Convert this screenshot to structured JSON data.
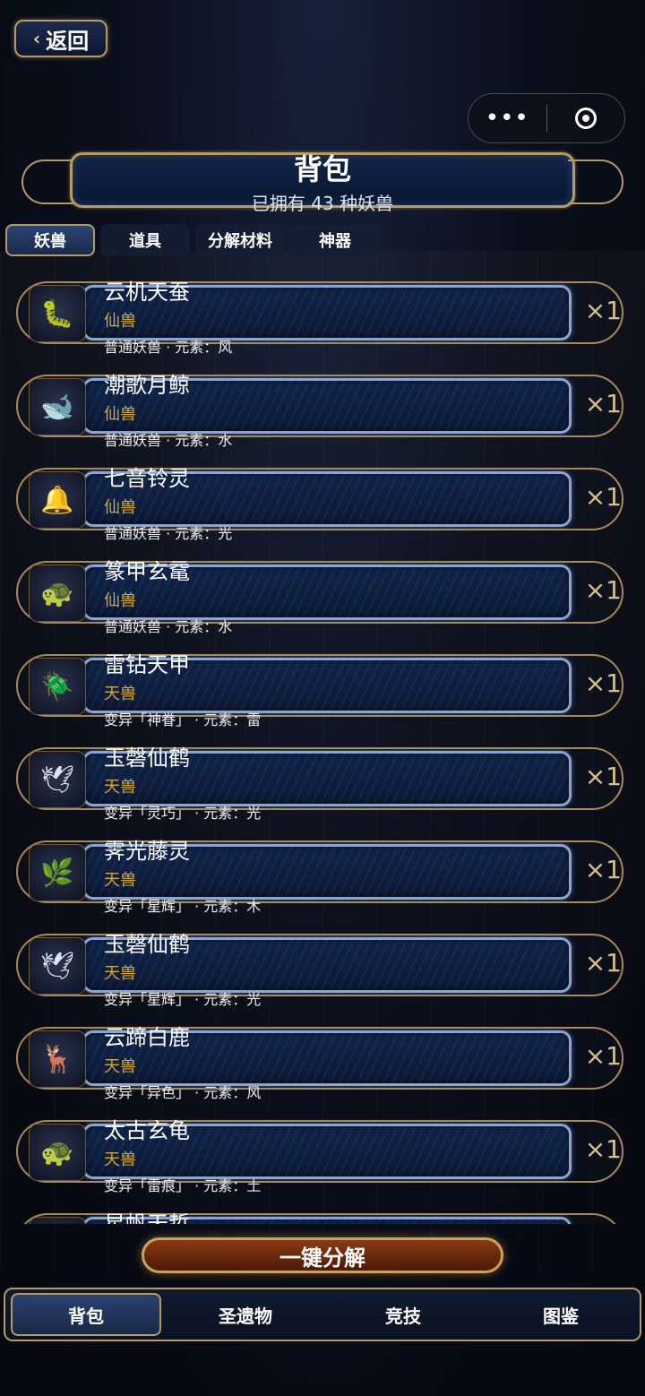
{
  "header": {
    "back_label": "返回",
    "title": "背包",
    "subtitle": "已拥有 43 种妖兽"
  },
  "tabs": [
    {
      "label": "妖兽",
      "active": true
    },
    {
      "label": "道具",
      "active": false
    },
    {
      "label": "分解材料",
      "active": false
    },
    {
      "label": "神器",
      "active": false
    }
  ],
  "items": [
    {
      "name": "云机天蚕",
      "rank": "仙兽",
      "detail": "普通妖兽 · 元素：风",
      "count": "×1",
      "icon": "silkworm-icon"
    },
    {
      "name": "潮歌月鲸",
      "rank": "仙兽",
      "detail": "普通妖兽 · 元素：水",
      "count": "×1",
      "icon": "whale-icon"
    },
    {
      "name": "七音铃灵",
      "rank": "仙兽",
      "detail": "普通妖兽 · 元素：光",
      "count": "×1",
      "icon": "bell-spirit-icon"
    },
    {
      "name": "篆甲玄鼋",
      "rank": "仙兽",
      "detail": "普通妖兽 · 元素：水",
      "count": "×1",
      "icon": "turtle-icon"
    },
    {
      "name": "雷钻天甲",
      "rank": "天兽",
      "detail": "变异「神眷」 · 元素：雷",
      "count": "×1",
      "icon": "beetle-icon"
    },
    {
      "name": "玉磬仙鹤",
      "rank": "天兽",
      "detail": "变异「灵巧」 · 元素：光",
      "count": "×1",
      "icon": "crane-icon"
    },
    {
      "name": "霁光藤灵",
      "rank": "天兽",
      "detail": "变异「星辉」 · 元素：木",
      "count": "×1",
      "icon": "vine-spirit-icon"
    },
    {
      "name": "玉磬仙鹤",
      "rank": "天兽",
      "detail": "变异「星辉」 · 元素：光",
      "count": "×1",
      "icon": "crane-icon"
    },
    {
      "name": "云蹄白鹿",
      "rank": "天兽",
      "detail": "变异「异色」 · 元素：风",
      "count": "×1",
      "icon": "deer-icon"
    },
    {
      "name": "太古玄龟",
      "rank": "天兽",
      "detail": "变异「雷痕」 · 元素：土",
      "count": "×1",
      "icon": "tortoise-icon"
    },
    {
      "name": "星帆天哲",
      "rank": "",
      "detail": "",
      "count": "",
      "icon": "sail-icon"
    }
  ],
  "batch_button": "一键分解",
  "bottom_nav": [
    {
      "label": "背包",
      "active": true
    },
    {
      "label": "圣遗物",
      "active": false
    },
    {
      "label": "竞技",
      "active": false
    },
    {
      "label": "图鉴",
      "active": false
    }
  ],
  "colors": {
    "accent_gold": "#b79a62",
    "rank_gold": "#d4a93c",
    "panel_blue": "#102448"
  }
}
